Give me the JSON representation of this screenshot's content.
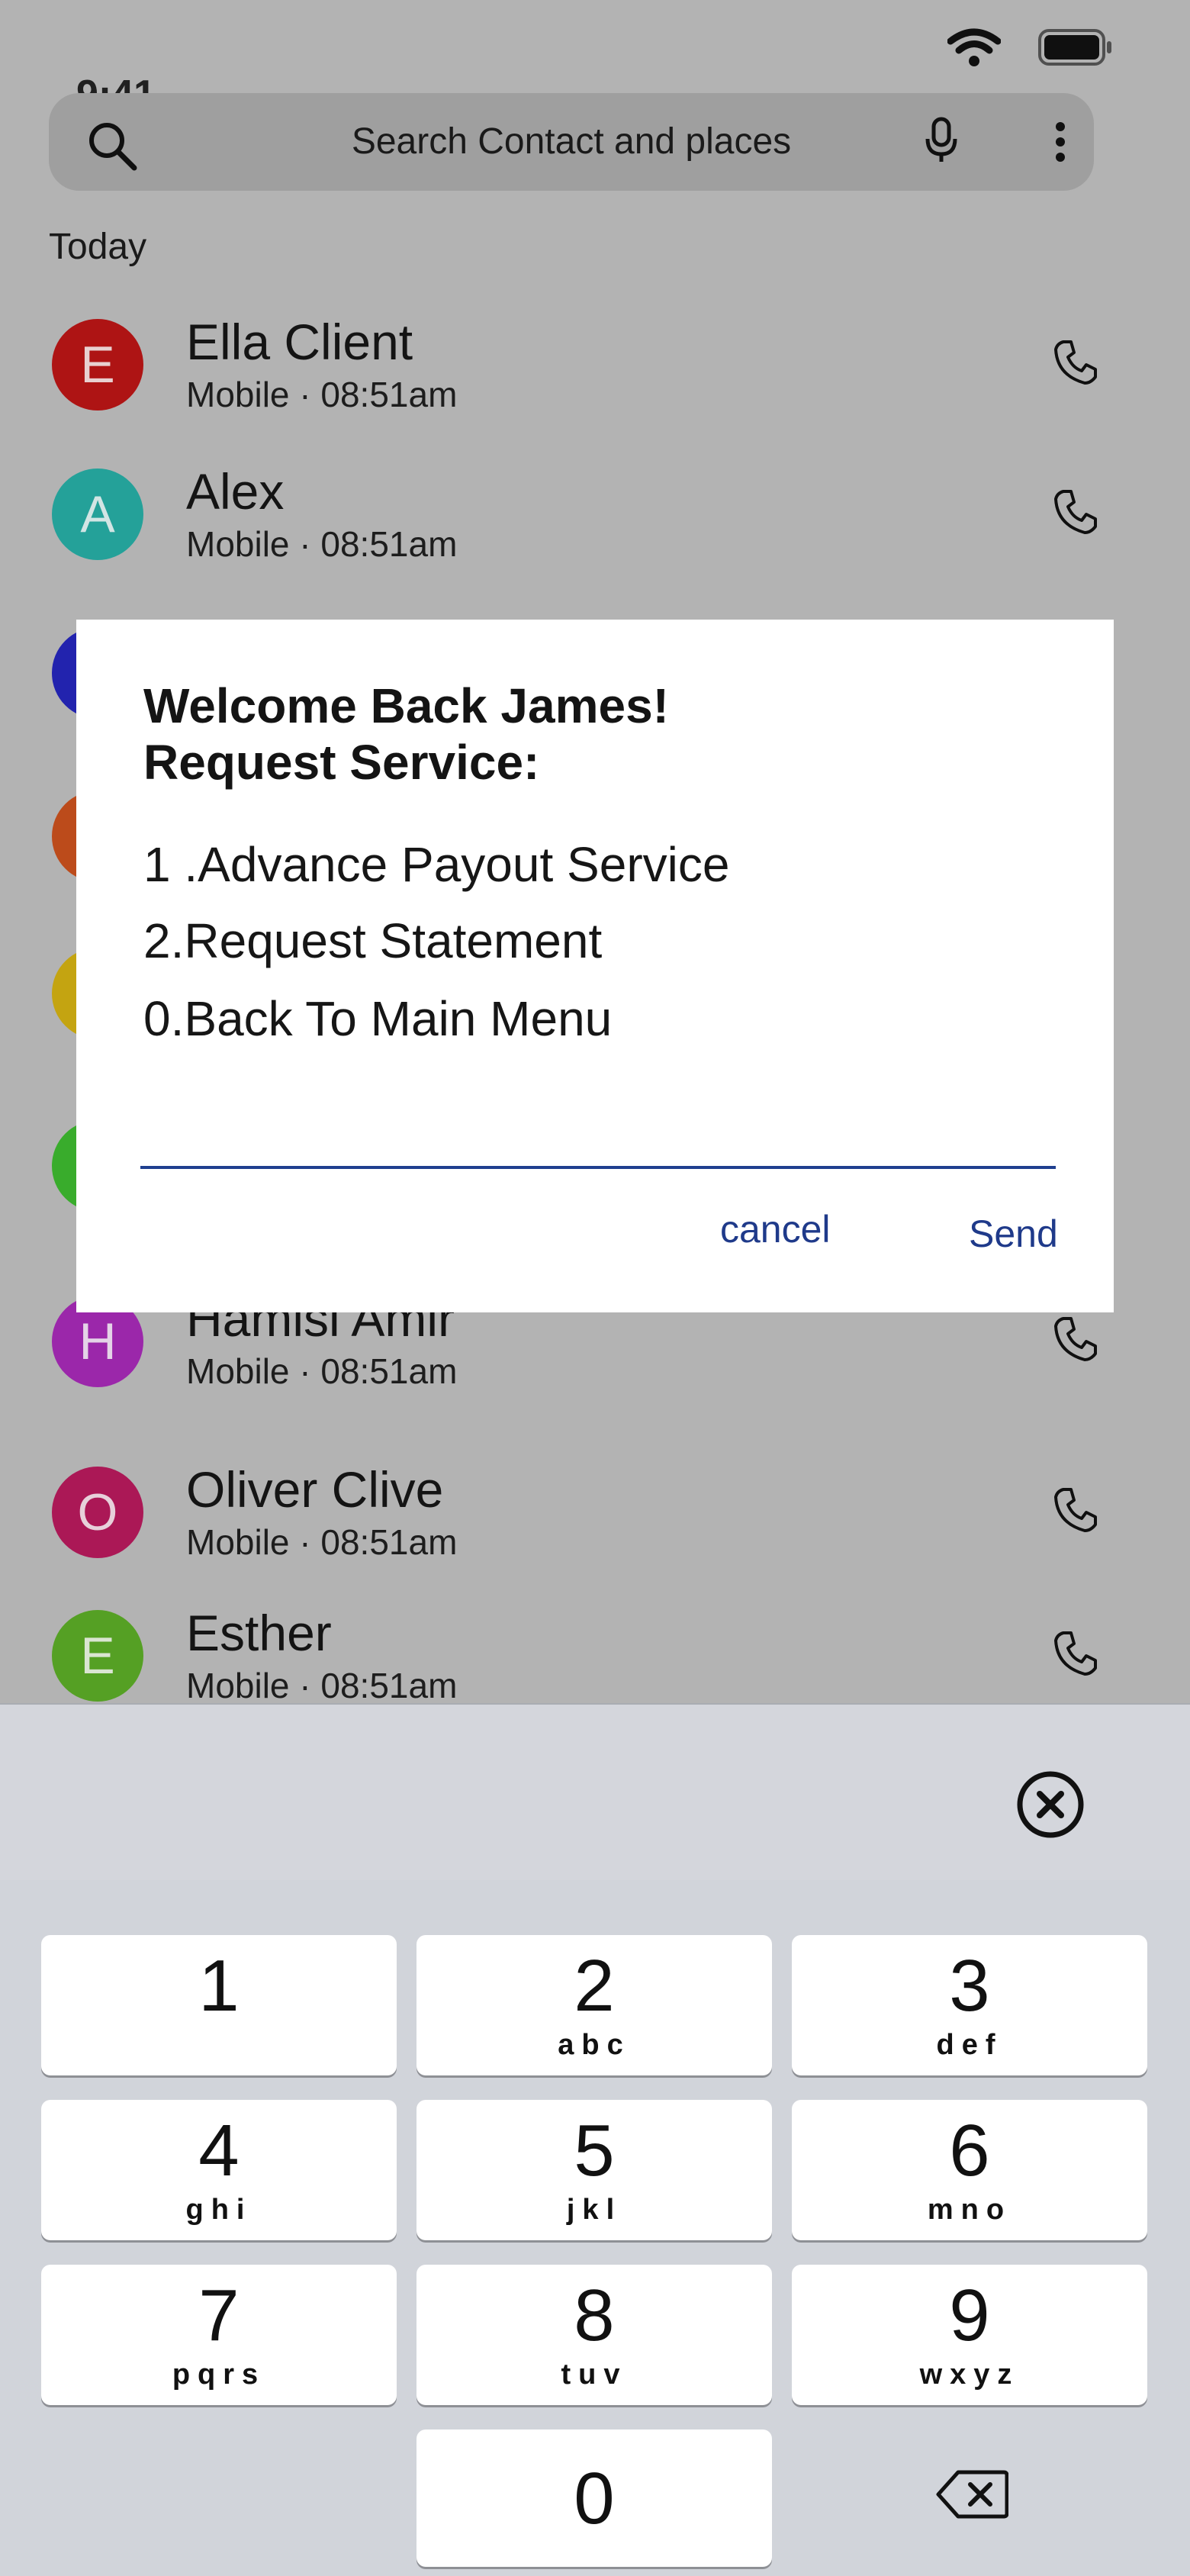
{
  "status_bar": {
    "time": "9:41"
  },
  "search": {
    "placeholder": "Search Contact and places"
  },
  "section": {
    "label": "Today"
  },
  "contacts": [
    {
      "initial": "E",
      "name": "Ella Client",
      "detail": "Mobile · 08:51am",
      "color": "#b81616"
    },
    {
      "initial": "A",
      "name": "Alex",
      "detail": "Mobile · 08:51am",
      "color": "#26aaa2"
    },
    {
      "initial": "",
      "name": "",
      "detail": "",
      "color": "#2425b8"
    },
    {
      "initial": "",
      "name": "",
      "detail": "",
      "color": "#c7501d"
    },
    {
      "initial": "",
      "name": "",
      "detail": "",
      "color": "#cfad12"
    },
    {
      "initial": "",
      "name": "",
      "detail": "",
      "color": "#3db62f"
    },
    {
      "initial": "H",
      "name": "Hamisi Amir",
      "detail": "Mobile · 08:51am",
      "color": "#a42ab4"
    },
    {
      "initial": "O",
      "name": "Oliver Clive",
      "detail": "Mobile · 08:51am",
      "color": "#b51a5b"
    },
    {
      "initial": "E",
      "name": "Esther",
      "detail": "Mobile · 08:51am",
      "color": "#5aa926"
    }
  ],
  "dialog": {
    "greeting": "Welcome Back James!",
    "subtitle": "Request Service:",
    "options": [
      "1 .Advance Payout Service",
      "2.Request Statement",
      "0.Back To Main Menu"
    ],
    "input_value": "",
    "cancel_label": "cancel",
    "send_label": "Send",
    "accent_color": "#1f3a8a"
  },
  "keypad": {
    "keys": [
      {
        "digit": "1",
        "letters": ""
      },
      {
        "digit": "2",
        "letters": "abc"
      },
      {
        "digit": "3",
        "letters": "def"
      },
      {
        "digit": "4",
        "letters": "ghi"
      },
      {
        "digit": "5",
        "letters": "jkl"
      },
      {
        "digit": "6",
        "letters": "mno"
      },
      {
        "digit": "7",
        "letters": "pqrs"
      },
      {
        "digit": "8",
        "letters": "tuv"
      },
      {
        "digit": "9",
        "letters": "wxyz"
      },
      {
        "digit": "0",
        "letters": ""
      }
    ]
  },
  "icons": {
    "search": "search-icon",
    "mic": "microphone-icon",
    "more": "more-vertical-icon",
    "call": "phone-icon",
    "clear": "clear-circle-icon",
    "backspace": "backspace-icon",
    "wifi": "wifi-icon",
    "battery": "battery-icon"
  }
}
